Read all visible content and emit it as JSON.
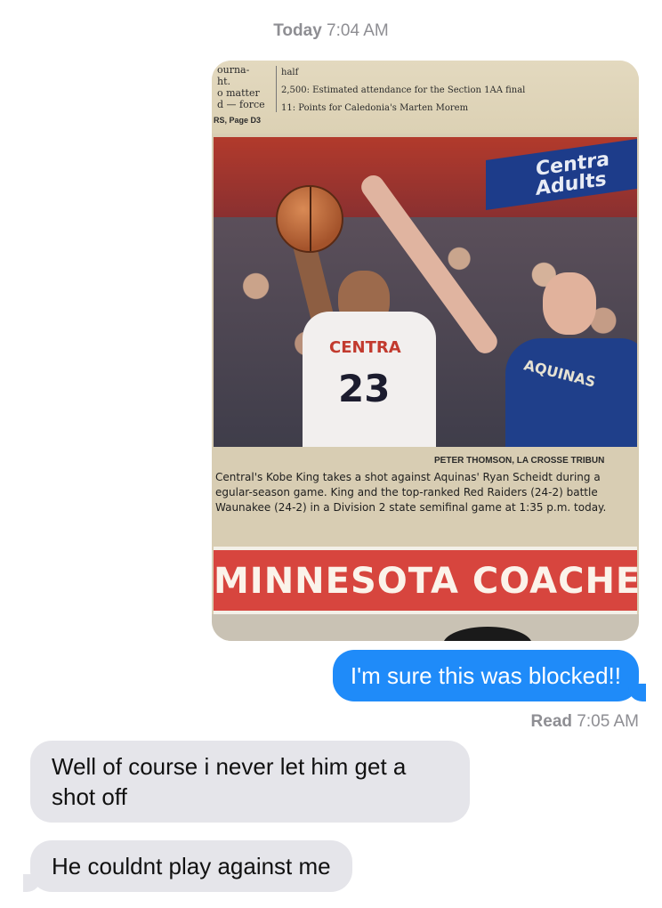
{
  "header": {
    "timestamp_day": "Today",
    "timestamp_time": "7:04 AM"
  },
  "photo": {
    "newspaper_left_lines": [
      "ourna-",
      "ht.",
      "o  matter",
      "d  —  force"
    ],
    "newspaper_stats": [
      "half",
      "2,500: Estimated attendance for the Section 1AA final",
      "11: Points for Caledonia's Marten Morem"
    ],
    "section_ref": "RS, Page D3",
    "sign_text": "Centra Adults",
    "jersey_left_team": "CENTRA",
    "jersey_left_number": "23",
    "jersey_right_team": "AQUINAS",
    "photo_credit": "PETER THOMSON, LA CROSSE TRIBUN",
    "caption": "Central's Kobe King takes a shot against Aquinas' Ryan Scheidt during a egular-season game. King and the top-ranked Red Raiders (24-2) battle Waunakee (24-2) in a Division 2 state semifinal game at 1:35 p.m. today.",
    "banner": "MINNESOTA COACHES"
  },
  "messages": {
    "outgoing": "I'm sure this was blocked!!",
    "read_label": "Read",
    "read_time": "7:05 AM",
    "incoming_1": "Well of course i never let him get a shot off",
    "incoming_2": "He couldnt play against me"
  },
  "colors": {
    "outgoing_bubble": "#1f8bf9",
    "incoming_bubble": "#e5e5ea",
    "meta_text": "#8e8e93"
  }
}
